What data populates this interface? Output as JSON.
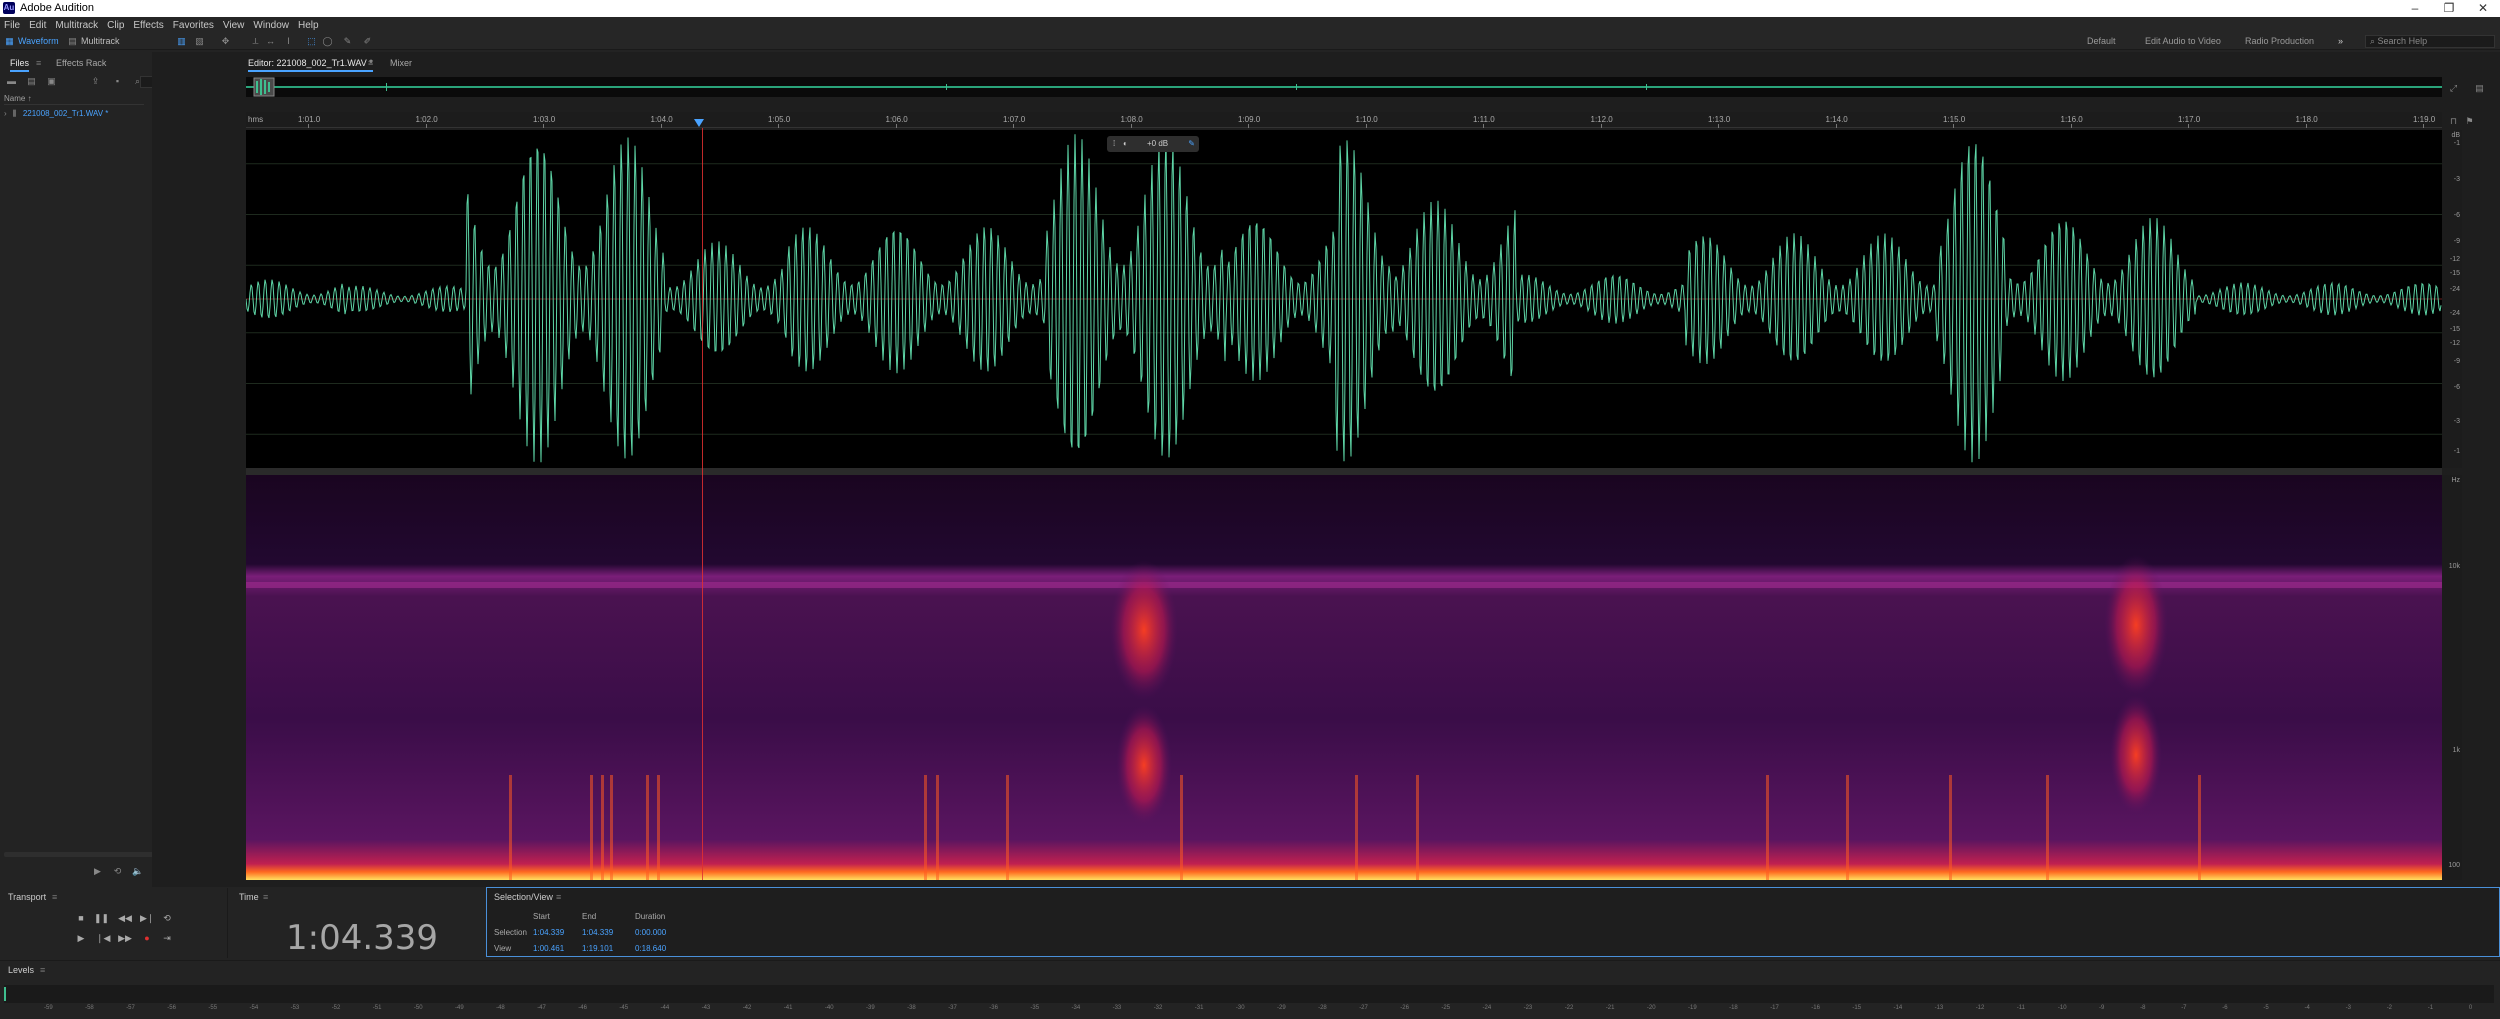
{
  "app": {
    "title": "Adobe Audition",
    "logo": "Au"
  },
  "window_controls": [
    "–",
    "❐",
    "✕"
  ],
  "menu": [
    "File",
    "Edit",
    "Multitrack",
    "Clip",
    "Effects",
    "Favorites",
    "View",
    "Window",
    "Help"
  ],
  "toolbar": {
    "waveform_label": "Waveform",
    "multitrack_label": "Multitrack",
    "workspaces": [
      "Default",
      "Edit Audio to Video",
      "Radio Production"
    ],
    "more": "»",
    "search_placeholder": "Search Help"
  },
  "files_panel": {
    "tabs": [
      "Files",
      "Effects Rack"
    ],
    "name_header": "Name ↑",
    "items": [
      {
        "name": "221008_002_Tr1.WAV *"
      }
    ]
  },
  "editor": {
    "tabs": [
      "Editor: 221008_002_Tr1.WAV *",
      "Mixer"
    ],
    "ruler_unit": "hms",
    "ruler_ticks": [
      "1:01.0",
      "1:02.0",
      "1:03.0",
      "1:04.0",
      "1:05.0",
      "1:06.0",
      "1:07.0",
      "1:08.0",
      "1:09.0",
      "1:10.0",
      "1:11.0",
      "1:12.0",
      "1:13.0",
      "1:14.0",
      "1:15.0",
      "1:16.0",
      "1:17.0",
      "1:18.0",
      "1:19.0"
    ],
    "hud_value": "+0 dB",
    "db_unit": "dB",
    "db_labels": [
      "-1",
      "-3",
      "-6",
      "-9",
      "-12",
      "-15",
      "-24",
      "-24",
      "-15",
      "-12",
      "-9",
      "-6",
      "-3",
      "-1"
    ],
    "hz_unit": "Hz",
    "hz_labels": [
      "10k",
      "1k",
      "100"
    ]
  },
  "transport": {
    "title": "Transport"
  },
  "time_panel": {
    "title": "Time",
    "value": "1:04.339"
  },
  "selection_view": {
    "title": "Selection/View",
    "columns": [
      "Start",
      "End",
      "Duration"
    ],
    "rows": [
      {
        "label": "Selection",
        "start": "1:04.339",
        "end": "1:04.339",
        "duration": "0:00.000"
      },
      {
        "label": "View",
        "start": "1:00.461",
        "end": "1:19.101",
        "duration": "0:18.640"
      }
    ]
  },
  "levels": {
    "title": "Levels",
    "ticks": [
      "-59",
      "-58",
      "-57",
      "-56",
      "-55",
      "-54",
      "-53",
      "-52",
      "-51",
      "-50",
      "-49",
      "-48",
      "-47",
      "-46",
      "-45",
      "-44",
      "-43",
      "-42",
      "-41",
      "-40",
      "-39",
      "-38",
      "-37",
      "-36",
      "-35",
      "-34",
      "-33",
      "-32",
      "-31",
      "-30",
      "-29",
      "-28",
      "-27",
      "-26",
      "-25",
      "-24",
      "-23",
      "-22",
      "-21",
      "-20",
      "-19",
      "-18",
      "-17",
      "-16",
      "-15",
      "-14",
      "-13",
      "-12",
      "-11",
      "-10",
      "-9",
      "-8",
      "-7",
      "-6",
      "-5",
      "-4",
      "-3",
      "-2",
      "-1",
      "0"
    ]
  },
  "colors": {
    "accent": "#4aa3ff",
    "waveform": "#5ed6a7",
    "playhead": "#e03030"
  }
}
